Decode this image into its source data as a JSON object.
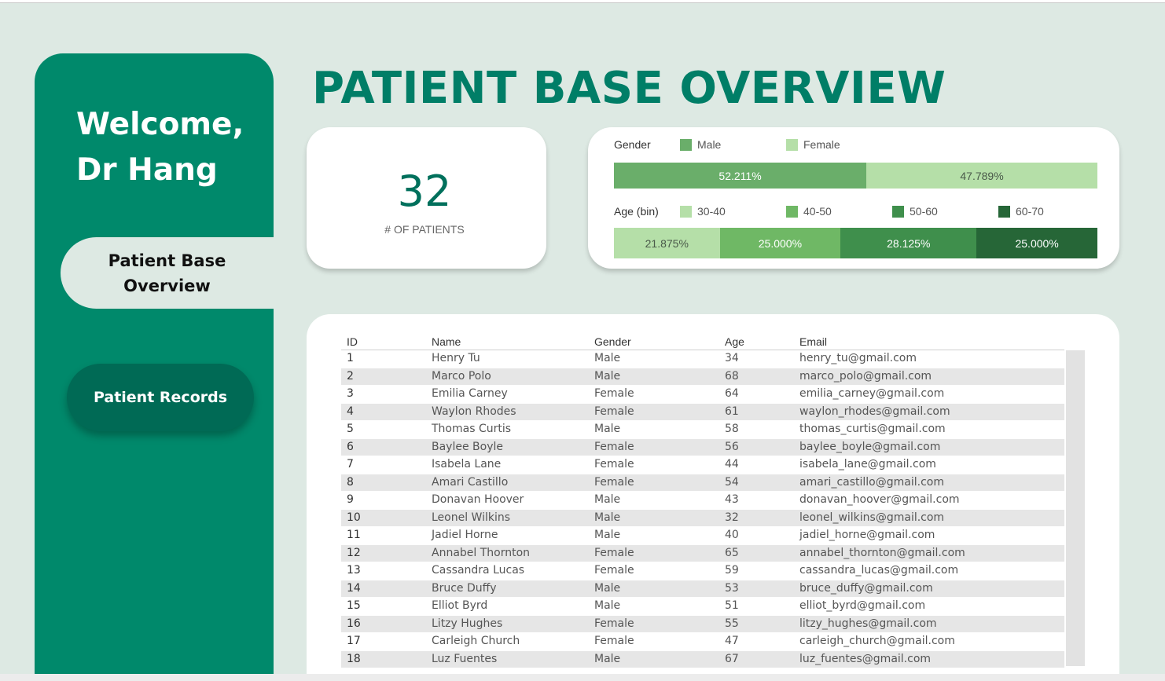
{
  "sidebar": {
    "welcome_line1": "Welcome,",
    "welcome_line2": "Dr Hang",
    "nav_active_label": "Patient Base Overview",
    "nav_records_label": "Patient Records"
  },
  "page_title": "PATIENT BASE OVERVIEW",
  "kpi": {
    "value": "32",
    "label": "# OF PATIENTS"
  },
  "colors": {
    "brand": "#00896b",
    "brand_dark": "#006a55",
    "male": "#6aae6a",
    "female": "#b5dfa8",
    "age_30_40": "#b5dfa8",
    "age_40_50": "#6fb865",
    "age_50_60": "#3f8f4c",
    "age_60_70": "#266637"
  },
  "chart_data": [
    {
      "type": "bar",
      "orientation": "horizontal-stacked-100",
      "legend_title": "Gender",
      "series": [
        {
          "name": "Male",
          "value": 52.211,
          "label": "52.211%"
        },
        {
          "name": "Female",
          "value": 47.789,
          "label": "47.789%"
        }
      ]
    },
    {
      "type": "bar",
      "orientation": "horizontal-stacked-100",
      "legend_title": "Age (bin)",
      "series": [
        {
          "name": "30-40",
          "value": 21.875,
          "label": "21.875%"
        },
        {
          "name": "40-50",
          "value": 25.0,
          "label": "25.000%"
        },
        {
          "name": "50-60",
          "value": 28.125,
          "label": "28.125%"
        },
        {
          "name": "60-70",
          "value": 25.0,
          "label": "25.000%"
        }
      ]
    }
  ],
  "table": {
    "headers": [
      "ID",
      "Name",
      "Gender",
      "Age",
      "Email"
    ],
    "rows": [
      [
        "1",
        "Henry Tu",
        "Male",
        "34",
        "henry_tu@gmail.com"
      ],
      [
        "2",
        "Marco Polo",
        "Male",
        "68",
        "marco_polo@gmail.com"
      ],
      [
        "3",
        "Emilia Carney",
        "Female",
        "64",
        "emilia_carney@gmail.com"
      ],
      [
        "4",
        "Waylon Rhodes",
        "Female",
        "61",
        "waylon_rhodes@gmail.com"
      ],
      [
        "5",
        "Thomas Curtis",
        "Male",
        "58",
        "thomas_curtis@gmail.com"
      ],
      [
        "6",
        "Baylee Boyle",
        "Female",
        "56",
        "baylee_boyle@gmail.com"
      ],
      [
        "7",
        "Isabela Lane",
        "Female",
        "44",
        "isabela_lane@gmail.com"
      ],
      [
        "8",
        "Amari Castillo",
        "Female",
        "54",
        "amari_castillo@gmail.com"
      ],
      [
        "9",
        "Donavan Hoover",
        "Male",
        "43",
        "donavan_hoover@gmail.com"
      ],
      [
        "10",
        "Leonel Wilkins",
        "Male",
        "32",
        "leonel_wilkins@gmail.com"
      ],
      [
        "11",
        "Jadiel Horne",
        "Male",
        "40",
        "jadiel_horne@gmail.com"
      ],
      [
        "12",
        "Annabel Thornton",
        "Female",
        "65",
        "annabel_thornton@gmail.com"
      ],
      [
        "13",
        "Cassandra Lucas",
        "Female",
        "59",
        "cassandra_lucas@gmail.com"
      ],
      [
        "14",
        "Bruce Duffy",
        "Male",
        "53",
        "bruce_duffy@gmail.com"
      ],
      [
        "15",
        "Elliot Byrd",
        "Male",
        "51",
        "elliot_byrd@gmail.com"
      ],
      [
        "16",
        "Litzy Hughes",
        "Female",
        "55",
        "litzy_hughes@gmail.com"
      ],
      [
        "17",
        "Carleigh Church",
        "Female",
        "47",
        "carleigh_church@gmail.com"
      ],
      [
        "18",
        "Luz Fuentes",
        "Male",
        "67",
        "luz_fuentes@gmail.com"
      ]
    ]
  }
}
